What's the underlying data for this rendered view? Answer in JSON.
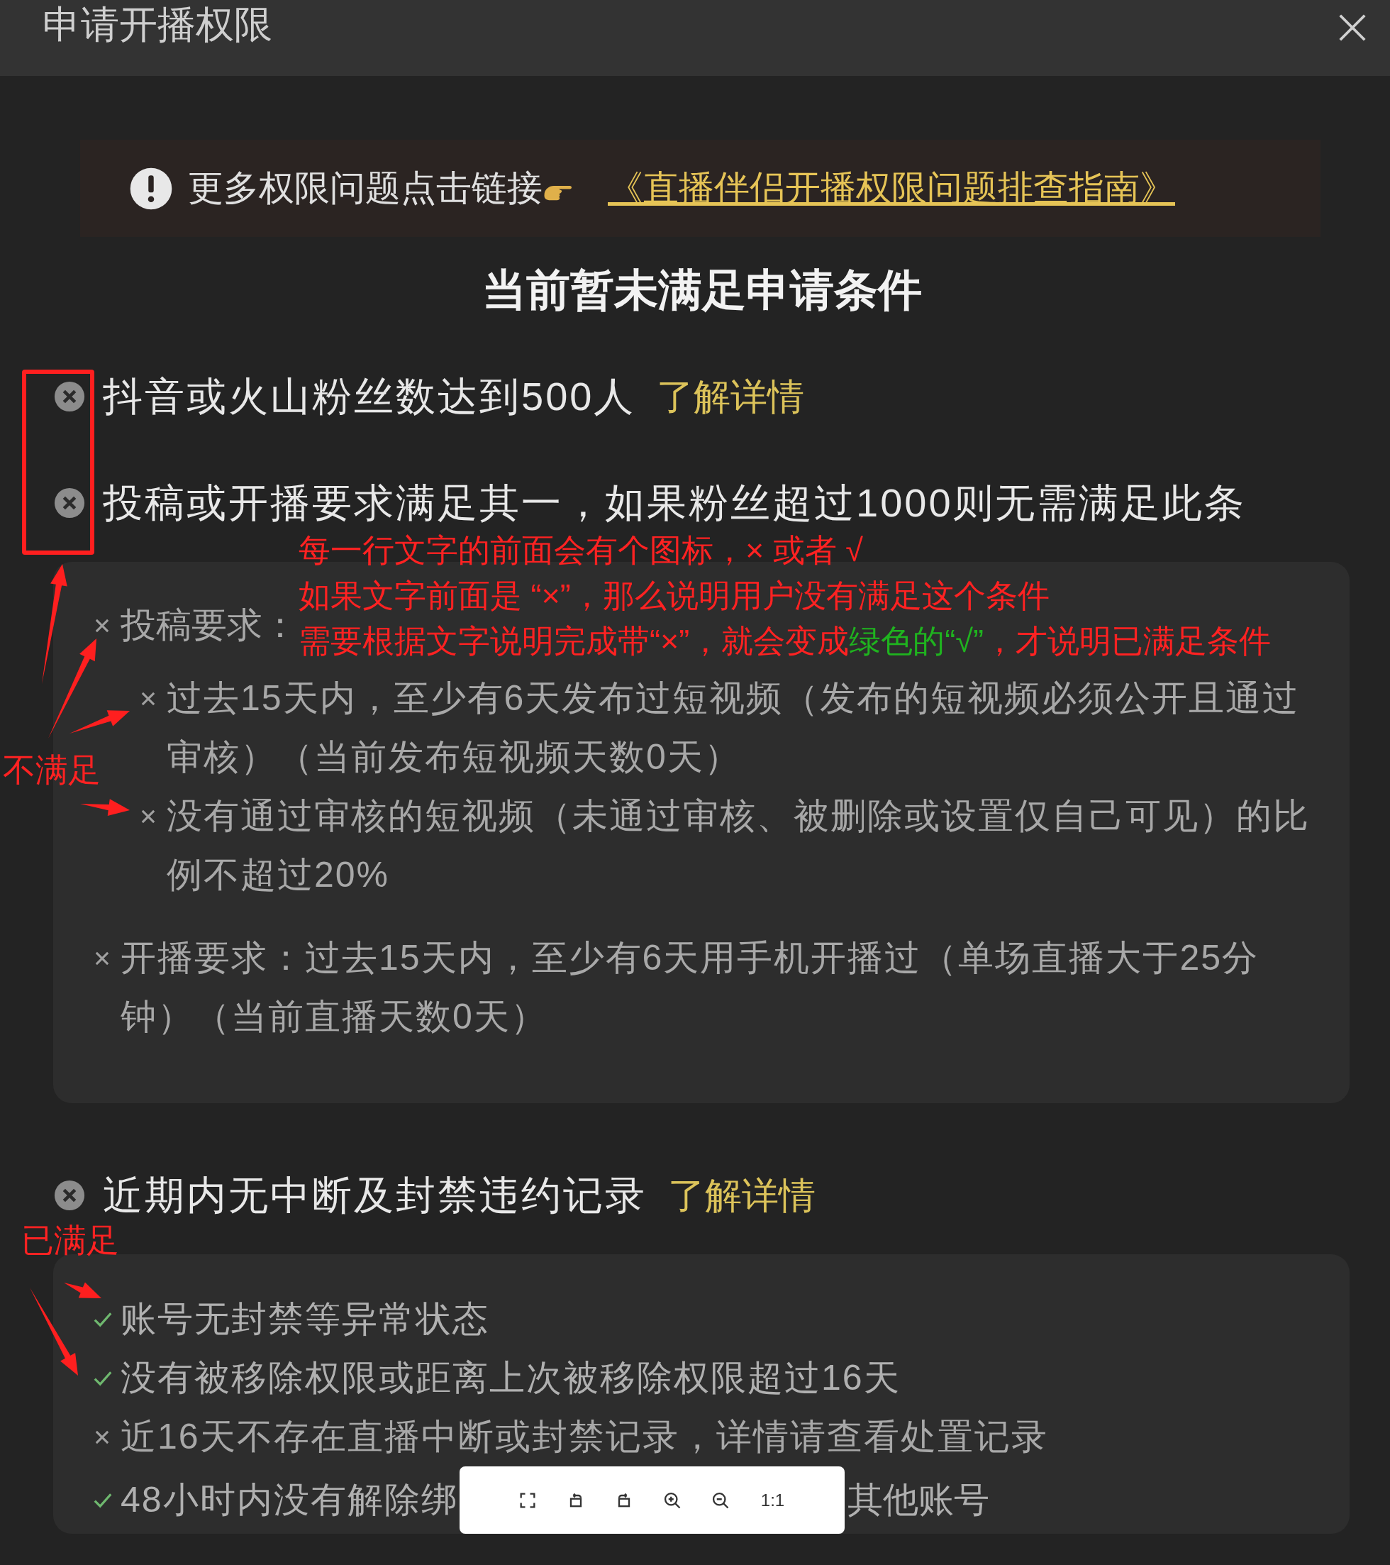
{
  "dialog": {
    "title": "申请开播权限"
  },
  "notice": {
    "text": "更多权限问题点击链接",
    "link": "《直播伴侣开播权限问题排查指南》"
  },
  "heading": "当前暂未满足申请条件",
  "conditions": [
    {
      "text": "抖音或火山粉丝数达到500人",
      "link": "了解详情",
      "met": false
    },
    {
      "text": "投稿或开播要求满足其一，如果粉丝超过1000则无需满足此条",
      "met": false,
      "details": [
        {
          "text": "投稿要求：",
          "met": false,
          "children": [
            {
              "text": "过去15天内，至少有6天发布过短视频（发布的短视频必须公开且通过审核）（当前发布短视频天数0天）",
              "met": false
            },
            {
              "text": "没有通过审核的短视频（未通过审核、被删除或设置仅自己可见）的比例不超过20%",
              "met": false
            }
          ]
        },
        {
          "text": "开播要求：过去15天内，至少有6天用手机开播过（单场直播大于25分钟）（当前直播天数0天）",
          "met": false
        }
      ]
    },
    {
      "text": "近期内无中断及封禁违约记录",
      "link": "了解详情",
      "met": false,
      "details": [
        {
          "text": "账号无封禁等异常状态",
          "met": true
        },
        {
          "text": "没有被移除权限或距离上次被移除权限超过16天",
          "met": true
        },
        {
          "text": "近16天不存在直播中断或封禁记录，详情请查看处置记录",
          "met": false
        },
        {
          "text": "48小时内没有解除绑",
          "text_after": "其他账号",
          "met": true
        }
      ]
    }
  ],
  "viewer_toolbar": [
    {
      "kind": "fit"
    },
    {
      "kind": "rotate_left"
    },
    {
      "kind": "rotate_right"
    },
    {
      "kind": "zoom_in"
    },
    {
      "kind": "zoom_out"
    },
    {
      "kind": "actual_size",
      "label": "1:1"
    }
  ],
  "annotations": {
    "note_lines": [
      [
        {
          "text": "每一行文字的前面会有个图标，× 或者 √",
          "color": "#ff2222"
        }
      ],
      [
        {
          "text": "如果文字前面是 “×”，那么说明用户没有满足这个条件",
          "color": "#ff2222"
        }
      ],
      [
        {
          "text": "需要根据文字说明完成带“×”，就会变成",
          "color": "#ff2222"
        },
        {
          "text": "绿色的“√”",
          "color": "#1fb31f"
        },
        {
          "text": "，才说明已满足条件",
          "color": "#ff2222"
        }
      ]
    ],
    "unmet_label": "不满足",
    "met_label": "已满足"
  }
}
